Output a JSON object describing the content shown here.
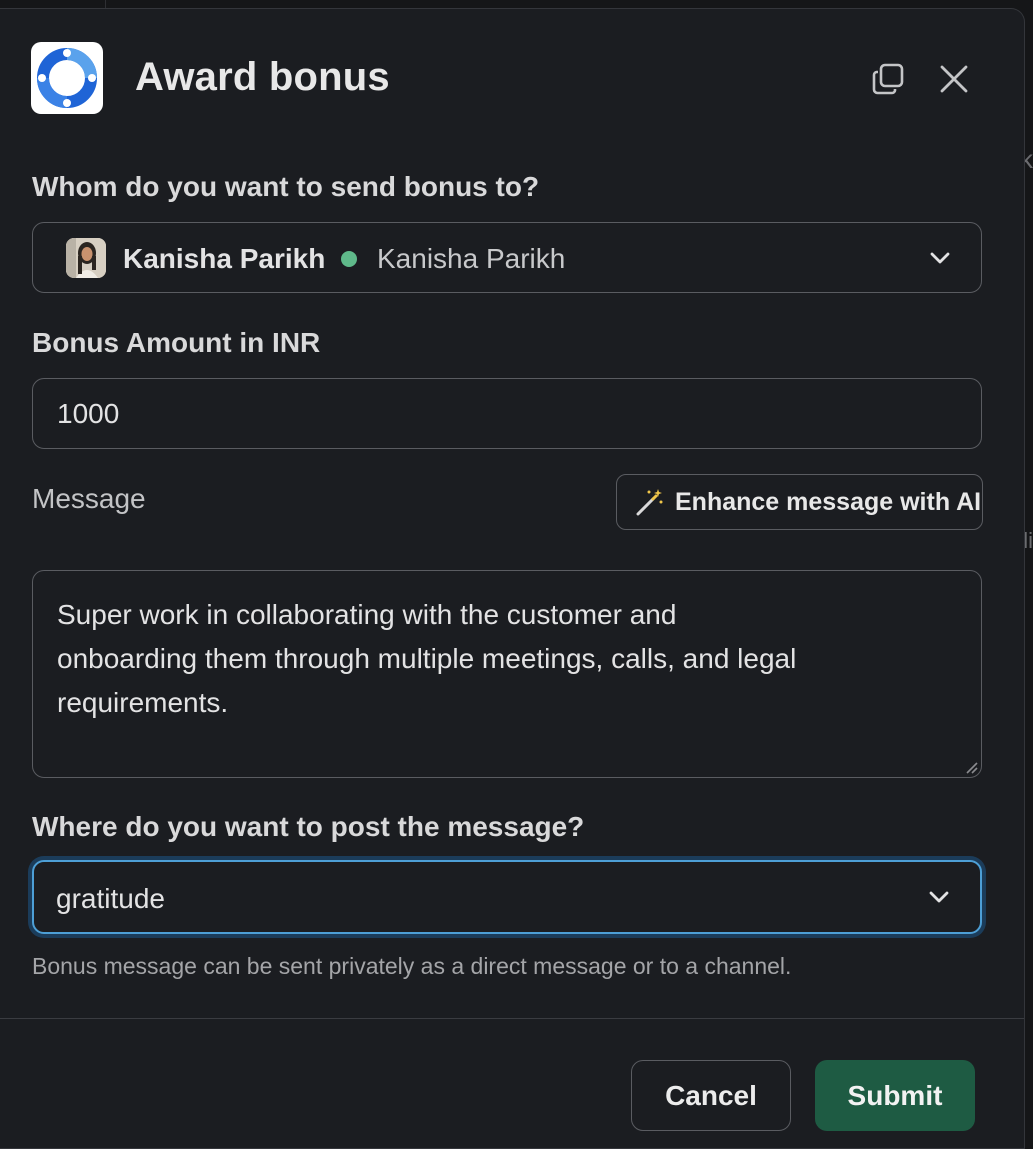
{
  "modal": {
    "title": "Award bonus",
    "app_icon": "app-logo-icon",
    "expand_icon": "expand-icon",
    "close_icon": "close-icon"
  },
  "recipient": {
    "label": "Whom do you want to send bonus to?",
    "selected_name": "Kanisha Parikh",
    "selected_display_name": "Kanisha Parikh",
    "presence": "active",
    "presence_color": "#5fb98a"
  },
  "amount": {
    "label": "Bonus Amount in INR",
    "value": "1000"
  },
  "message": {
    "label": "Message",
    "enhance_button_label": "Enhance message with AI",
    "enhance_icon": "magic-wand-icon",
    "value": "Super work in collaborating with the customer and\nonboarding them through multiple meetings, calls, and legal\nrequirements."
  },
  "channel": {
    "label": "Where do you want to post the message?",
    "selected_value": "gratitude",
    "hint": "Bonus message can be sent privately as a direct message or to a channel."
  },
  "footer": {
    "cancel_label": "Cancel",
    "submit_label": "Submit"
  },
  "background": {
    "peek_text_1": "k",
    "peek_text_2": "li"
  },
  "colors": {
    "submit": "#1e5b43",
    "focus_ring": "#4d9fd6",
    "modal_bg": "#1b1d21"
  }
}
